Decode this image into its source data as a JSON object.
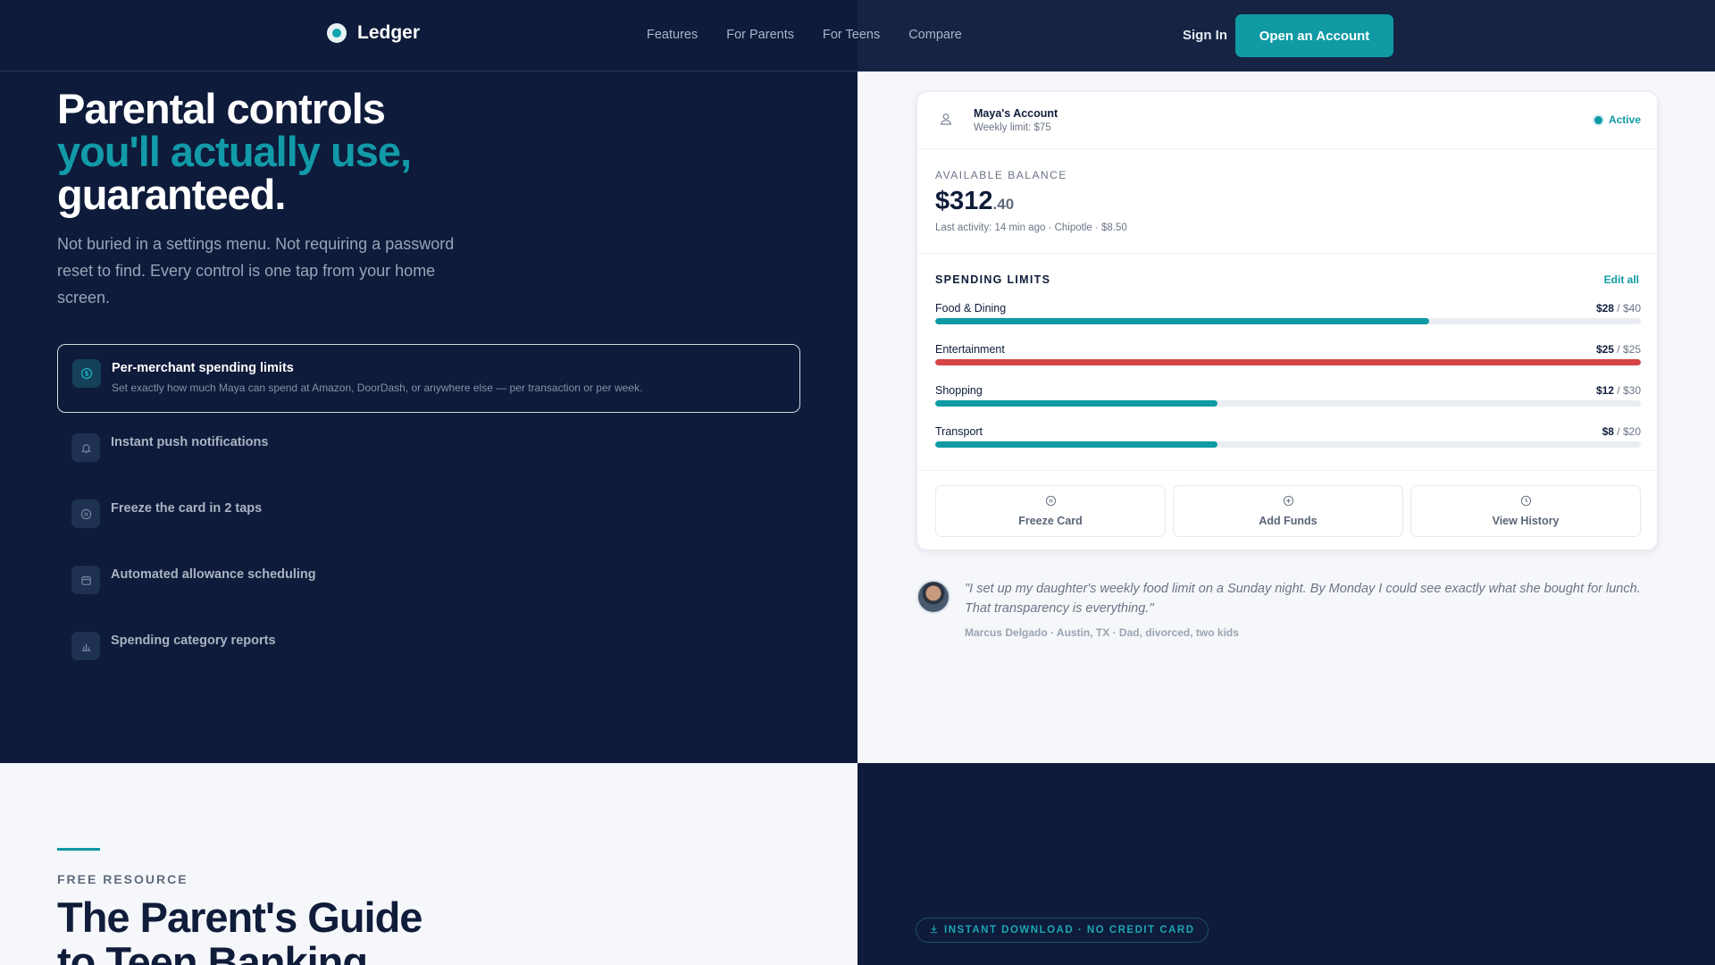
{
  "nav": {
    "brand": "Ledger",
    "links": [
      "Features",
      "For Parents",
      "For Teens",
      "Compare"
    ],
    "sign_in": "Sign In",
    "cta": "Open an Account"
  },
  "hero": {
    "title_line1": "Parental controls",
    "title_line2": "you'll actually use,",
    "title_line3": "guaranteed.",
    "lede": "Not buried in a settings menu. Not requiring a password reset to find. Every control is one tap from your home screen.",
    "active_feature": {
      "title": "Per-merchant spending limits",
      "desc": "Set exactly how much Maya can spend at Amazon, DoorDash, or anywhere else — per transaction or per week.",
      "icon": "dollar-icon"
    },
    "features": [
      {
        "title": "Instant push notifications",
        "icon": "bell-icon"
      },
      {
        "title": "Freeze the card in 2 taps",
        "icon": "pause-icon"
      },
      {
        "title": "Automated allowance scheduling",
        "icon": "calendar-icon"
      },
      {
        "title": "Spending category reports",
        "icon": "bar-chart-icon"
      }
    ]
  },
  "account": {
    "name": "Maya's Account",
    "weekly_limit": "Weekly limit: $75",
    "status": "Active",
    "balance_label": "AVAILABLE BALANCE",
    "balance_dollars": "$312",
    "balance_cents": ".40",
    "last_activity": "Last activity: 14 min ago · Chipotle · $8.50",
    "limits_title": "SPENDING LIMITS",
    "edit_all": "Edit all",
    "limits": [
      {
        "name": "Food & Dining",
        "spent": "$28",
        "cap": " / $40",
        "fraction": 0.7,
        "over": false
      },
      {
        "name": "Entertainment",
        "spent": "$25",
        "cap": " / $25",
        "fraction": 1.0,
        "over": true
      },
      {
        "name": "Shopping",
        "spent": "$12",
        "cap": " / $30",
        "fraction": 0.4,
        "over": false
      },
      {
        "name": "Transport",
        "spent": "$8",
        "cap": " / $20",
        "fraction": 0.4,
        "over": false
      }
    ],
    "actions": [
      {
        "label": "Freeze Card",
        "icon": "pause-icon"
      },
      {
        "label": "Add Funds",
        "icon": "plus-circle-icon"
      },
      {
        "label": "View History",
        "icon": "clock-icon"
      }
    ]
  },
  "testimonial": {
    "quote": "\"I set up my daughter's weekly food limit on a Sunday night. By Monday I could see exactly what she bought for lunch. That transparency is everything.\"",
    "author": "Marcus Delgado · Austin, TX · Dad, divorced, two kids"
  },
  "resource": {
    "eyebrow": "FREE RESOURCE",
    "title_line1": "The Parent's Guide",
    "title_line2": "to Teen Banking",
    "pill": "INSTANT DOWNLOAD · NO CREDIT CARD"
  },
  "colors": {
    "navy": "#0e1b3a",
    "teal": "#0f9aa4",
    "danger": "#d64545"
  }
}
